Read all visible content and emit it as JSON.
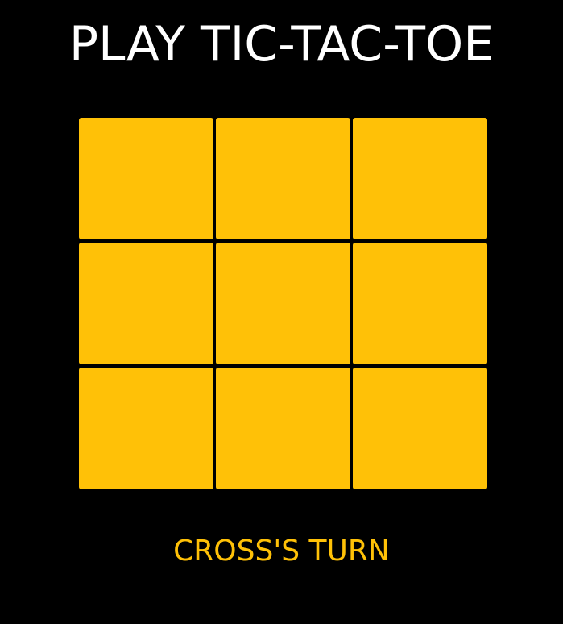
{
  "title": "PLAY TIC-TAC-TOE",
  "board": {
    "cells": [
      "",
      "",
      "",
      "",
      "",
      "",
      "",
      "",
      ""
    ]
  },
  "status": "CROSS'S TURN",
  "colors": {
    "background": "#000000",
    "title": "#ffffff",
    "cell": "#ffc107",
    "status": "#ffc107"
  }
}
